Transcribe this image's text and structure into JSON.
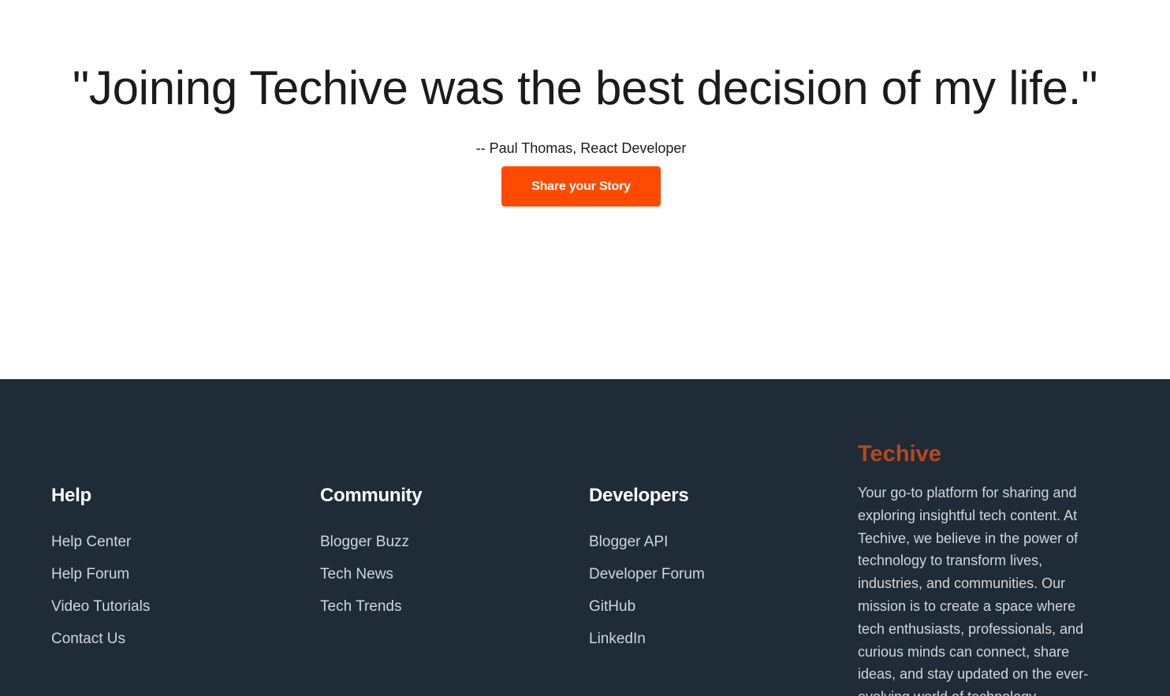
{
  "testimonial": {
    "quote": "\"Joining Techive was the best decision of my life.\"",
    "author": "-- Paul Thomas, React Developer",
    "cta_label": "Share your Story"
  },
  "footer": {
    "columns": [
      {
        "heading": "Help",
        "links": [
          "Help Center",
          "Help Forum",
          "Video Tutorials",
          "Contact Us"
        ]
      },
      {
        "heading": "Community",
        "links": [
          "Blogger Buzz",
          "Tech News",
          "Tech Trends"
        ]
      },
      {
        "heading": "Developers",
        "links": [
          "Blogger API",
          "Developer Forum",
          "GitHub",
          "LinkedIn"
        ]
      }
    ],
    "brand": {
      "title": "Techive",
      "description": "Your go-to platform for sharing and exploring insightful tech content. At Techive, we believe in the power of technology to transform lives, industries, and communities. Our mission is to create a space where tech enthusiasts, professionals, and curious minds can connect, share ideas, and stay updated on the ever-evolving world of technology."
    }
  },
  "colors": {
    "accent": "#ff4a00",
    "brand": "#b8471a",
    "footer_bg": "#1f2b36",
    "text_dark": "#1b1b1b",
    "footer_link": "#d2d5d9"
  }
}
